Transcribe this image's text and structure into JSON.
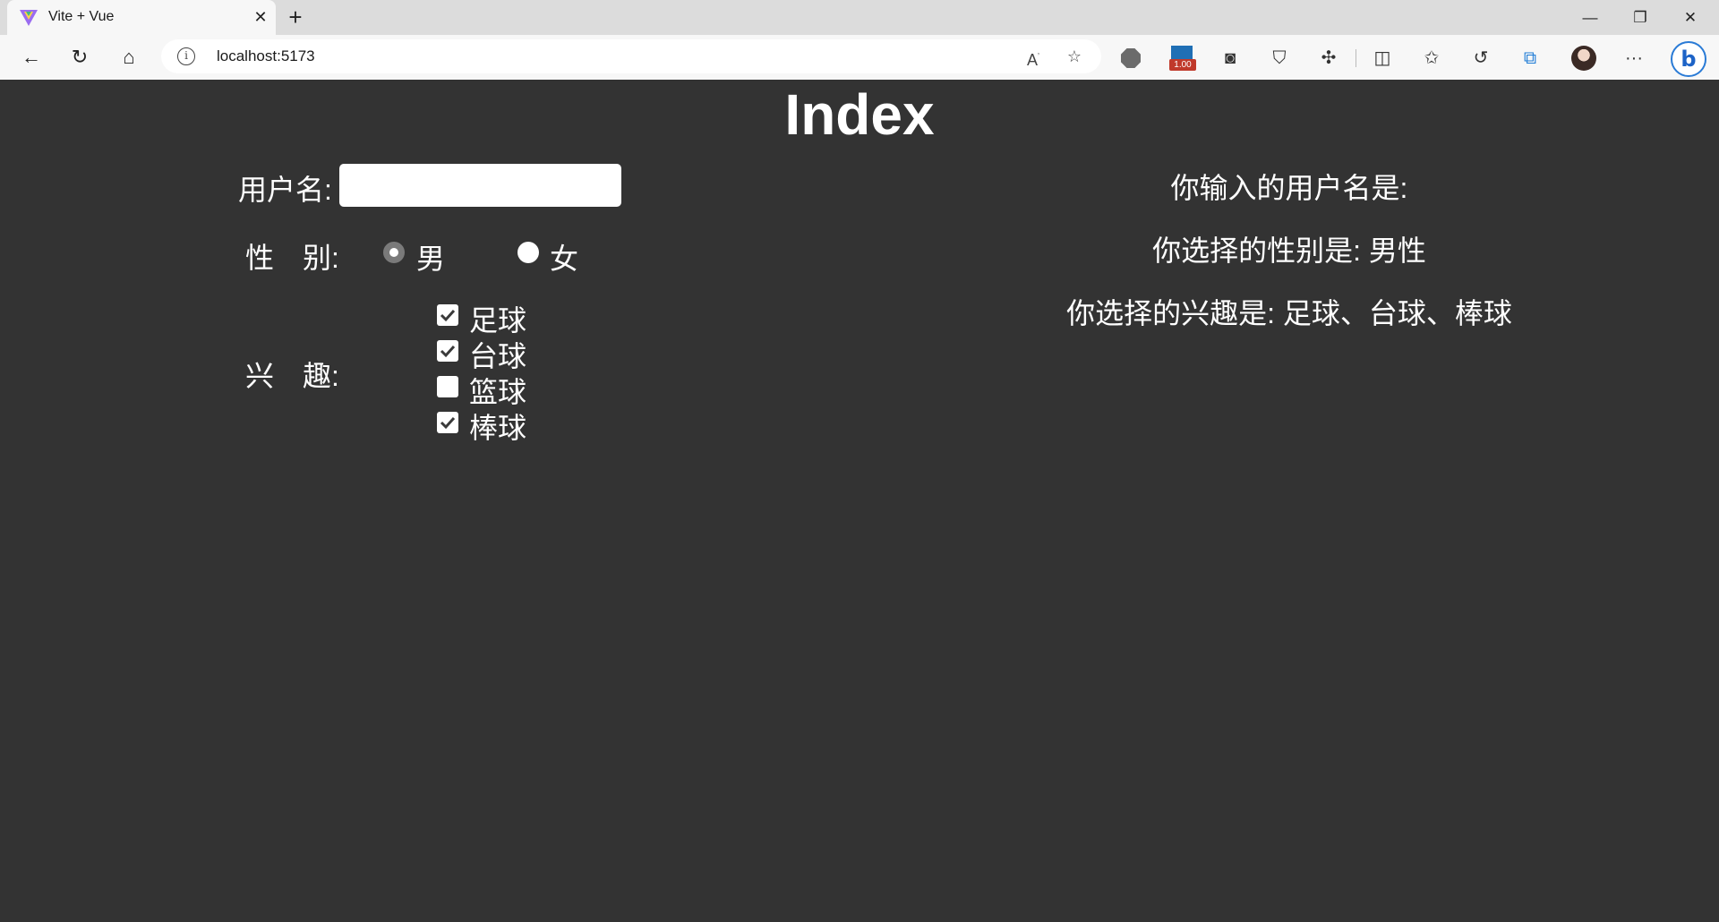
{
  "browser": {
    "tab_title": "Vite + Vue",
    "url": "localhost:5173",
    "extension_badge": "1.00",
    "icons": {
      "back": "back-arrow-icon",
      "refresh": "refresh-icon",
      "home": "home-icon",
      "info": "site-info-icon",
      "read_aloud": "read-aloud-icon",
      "favorite": "add-favorite-icon",
      "extensions": "puzzle-icon",
      "split": "split-screen-icon",
      "favorites": "favorites-star-icon",
      "history": "history-icon",
      "collections": "collections-icon",
      "more": "more-dots-icon",
      "bing": "bing-icon"
    },
    "accent_color": "#2a7bd6"
  },
  "page": {
    "title": "Index",
    "background": "#333333",
    "form": {
      "username_label": "用户名:",
      "username_value": "",
      "gender_label": "性　别:",
      "gender_options": [
        {
          "label": "男",
          "checked": true
        },
        {
          "label": "女",
          "checked": false
        }
      ],
      "hobby_label": "兴　趣:",
      "hobby_options": [
        {
          "label": "足球",
          "checked": true
        },
        {
          "label": "台球",
          "checked": true
        },
        {
          "label": "篮球",
          "checked": false
        },
        {
          "label": "棒球",
          "checked": true
        }
      ]
    },
    "results": {
      "username_line": "你输入的用户名是:",
      "gender_line": "你选择的性别是: 男性",
      "hobby_line": "你选择的兴趣是: 足球、台球、棒球"
    }
  }
}
